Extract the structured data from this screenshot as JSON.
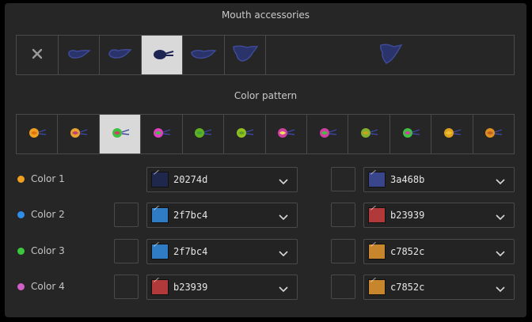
{
  "mouth": {
    "title": "Mouth accessories",
    "items": [
      {
        "name": "none-icon"
      },
      {
        "name": "mouth-accessory-1-icon"
      },
      {
        "name": "mouth-accessory-2-icon"
      },
      {
        "name": "mouth-accessory-3-icon",
        "selected": true
      },
      {
        "name": "mouth-accessory-4-icon"
      },
      {
        "name": "mouth-accessory-5-icon"
      },
      {
        "name": "mouth-accessory-6-icon"
      }
    ]
  },
  "pattern": {
    "title": "Color pattern",
    "items": [
      {
        "name": "pattern-1-icon",
        "colors": [
          "#f0a020",
          "#e07010"
        ]
      },
      {
        "name": "pattern-2-icon",
        "colors": [
          "#e8a030",
          "#c04070"
        ]
      },
      {
        "name": "pattern-3-icon",
        "colors": [
          "#40c040",
          "#d04060"
        ],
        "selected": true
      },
      {
        "name": "pattern-4-icon",
        "colors": [
          "#e040c0",
          "#40c040"
        ]
      },
      {
        "name": "pattern-5-icon",
        "colors": [
          "#60b020",
          "#40a040"
        ]
      },
      {
        "name": "pattern-6-icon",
        "colors": [
          "#90c020",
          "#60a020"
        ]
      },
      {
        "name": "pattern-7-icon",
        "colors": [
          "#d040a0",
          "#f0e060"
        ]
      },
      {
        "name": "pattern-8-icon",
        "colors": [
          "#d040a0",
          "#40c040"
        ]
      },
      {
        "name": "pattern-9-icon",
        "colors": [
          "#80b030",
          "#d0a020"
        ]
      },
      {
        "name": "pattern-10-icon",
        "colors": [
          "#40c040",
          "#d040a0"
        ]
      },
      {
        "name": "pattern-11-icon",
        "colors": [
          "#e0a020",
          "#f0c030"
        ]
      },
      {
        "name": "pattern-12-icon",
        "colors": [
          "#e09020",
          "#c06020"
        ]
      }
    ]
  },
  "colors": [
    {
      "label": "Color 1",
      "dot": "#f0a020",
      "left_hex": "20274d",
      "left_color": "#20274d",
      "right_hex": "3a468b",
      "right_color": "#3a468b",
      "left_check": false
    },
    {
      "label": "Color 2",
      "dot": "#2f8fe8",
      "left_hex": "2f7bc4",
      "left_color": "#2f7bc4",
      "right_hex": "b23939",
      "right_color": "#b23939",
      "left_check": true
    },
    {
      "label": "Color 3",
      "dot": "#3cc83c",
      "left_hex": "2f7bc4",
      "left_color": "#2f7bc4",
      "right_hex": "c7852c",
      "right_color": "#c7852c",
      "left_check": true
    },
    {
      "label": "Color 4",
      "dot": "#d060c8",
      "left_hex": "b23939",
      "left_color": "#b23939",
      "right_hex": "c7852c",
      "right_color": "#c7852c",
      "left_check": true
    }
  ]
}
